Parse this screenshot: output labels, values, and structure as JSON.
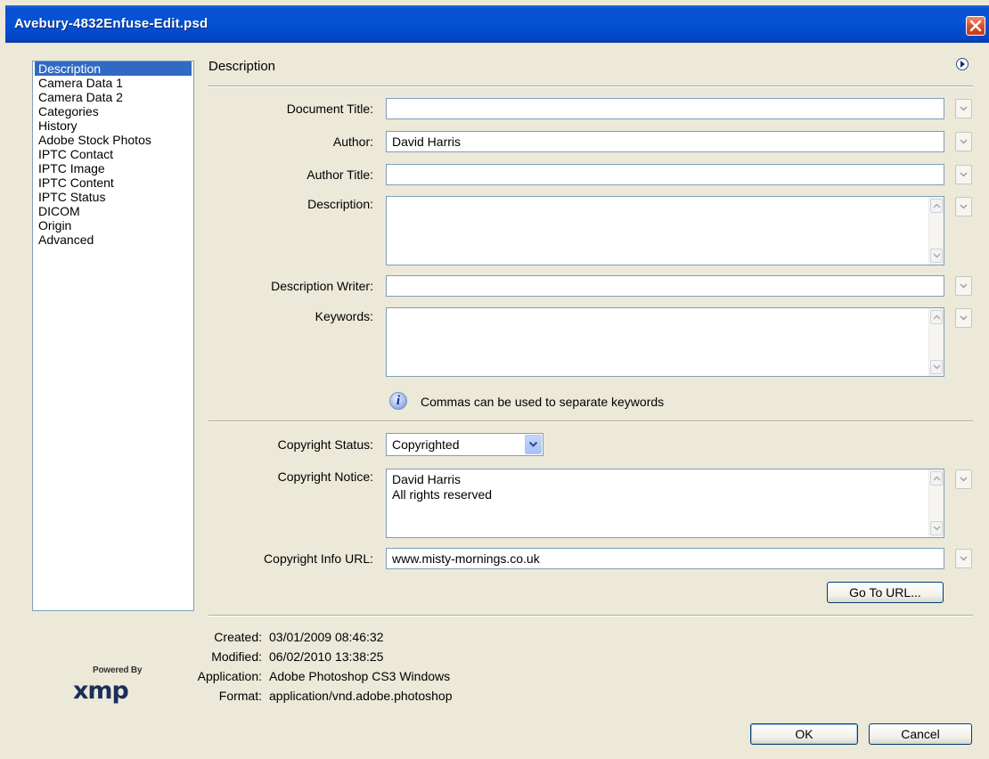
{
  "window": {
    "title": "Avebury-4832Enfuse-Edit.psd"
  },
  "categories": [
    "Description",
    "Camera Data 1",
    "Camera Data 2",
    "Categories",
    "History",
    "Adobe Stock Photos",
    "IPTC Contact",
    "IPTC Image",
    "IPTC Content",
    "IPTC Status",
    "DICOM",
    "Origin",
    "Advanced"
  ],
  "selected_category": "Description",
  "section_title": "Description",
  "form": {
    "document_title_label": "Document Title:",
    "document_title_value": "",
    "author_label": "Author:",
    "author_value": "David Harris",
    "author_title_label": "Author Title:",
    "author_title_value": "",
    "description_label": "Description:",
    "description_value": "",
    "description_writer_label": "Description Writer:",
    "description_writer_value": "",
    "keywords_label": "Keywords:",
    "keywords_value": "",
    "keywords_hint": "Commas can be used to separate keywords",
    "copyright_status_label": "Copyright Status:",
    "copyright_status_value": "Copyrighted",
    "copyright_notice_label": "Copyright Notice:",
    "copyright_notice_value": "David Harris\nAll rights reserved",
    "copyright_url_label": "Copyright Info URL:",
    "copyright_url_value": "www.misty-mornings.co.uk",
    "go_to_url_label": "Go To URL..."
  },
  "info": {
    "created_label": "Created:",
    "created_value": "03/01/2009 08:46:32",
    "modified_label": "Modified:",
    "modified_value": "06/02/2010 13:38:25",
    "application_label": "Application:",
    "application_value": "Adobe Photoshop CS3 Windows",
    "format_label": "Format:",
    "format_value": "application/vnd.adobe.photoshop"
  },
  "logo": {
    "powered_by": "Powered By",
    "name": "xmp"
  },
  "buttons": {
    "ok": "OK",
    "cancel": "Cancel"
  },
  "colors": {
    "titlebar": "#0553d6",
    "selection": "#316ac5",
    "dialog_bg": "#ece9d8",
    "close": "#d64d2c"
  }
}
